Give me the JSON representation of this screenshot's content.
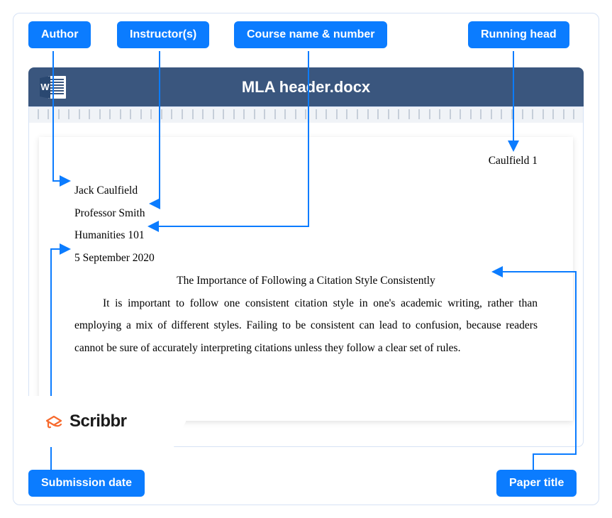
{
  "labels": {
    "author": "Author",
    "instructor": "Instructor(s)",
    "course": "Course name & number",
    "running_head": "Running head",
    "submission_date": "Submission date",
    "paper_title": "Paper title"
  },
  "word": {
    "title": "MLA header.docx"
  },
  "document": {
    "running_head": "Caulfield 1",
    "author": "Jack Caulfield",
    "instructor": "Professor Smith",
    "course": "Humanities 101",
    "date": "5 September 2020",
    "title": "The Importance of Following a Citation Style Consistently",
    "body": "It is important to follow one consistent citation style in one's academic writing, rather than employing a mix of different styles. Failing to be consistent can lead to confusion, because readers cannot be sure of accurately interpreting citations unless they follow a clear set of rules."
  },
  "brand": {
    "name": "Scribbr"
  },
  "colors": {
    "accent": "#0b7cff",
    "word_header": "#3a567e",
    "brand_orange": "#f76a2d"
  }
}
